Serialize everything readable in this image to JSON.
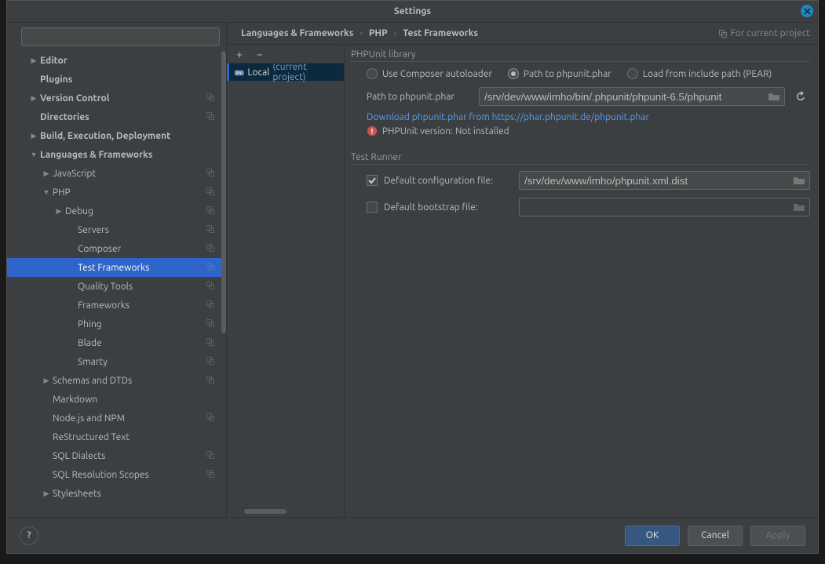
{
  "title": "Settings",
  "breadcrumb": [
    "Languages & Frameworks",
    "PHP",
    "Test Frameworks"
  ],
  "for_project_label": "For current project",
  "sidebar": {
    "search_placeholder": "",
    "items": [
      {
        "label": "Editor",
        "bold": true,
        "indent": 1,
        "chev": "right"
      },
      {
        "label": "Plugins",
        "bold": true,
        "indent": 1,
        "chev": ""
      },
      {
        "label": "Version Control",
        "bold": true,
        "indent": 1,
        "chev": "right",
        "copy": true
      },
      {
        "label": "Directories",
        "bold": true,
        "indent": 1,
        "chev": "",
        "copy": true
      },
      {
        "label": "Build, Execution, Deployment",
        "bold": true,
        "indent": 1,
        "chev": "right"
      },
      {
        "label": "Languages & Frameworks",
        "bold": true,
        "indent": 1,
        "chev": "down"
      },
      {
        "label": "JavaScript",
        "indent": 2,
        "chev": "right",
        "copy": true
      },
      {
        "label": "PHP",
        "indent": 2,
        "chev": "down",
        "copy": true
      },
      {
        "label": "Debug",
        "indent": 3,
        "chev": "right",
        "copy": true
      },
      {
        "label": "Servers",
        "indent": 4,
        "copy": true
      },
      {
        "label": "Composer",
        "indent": 4,
        "copy": true
      },
      {
        "label": "Test Frameworks",
        "indent": 4,
        "copy": true,
        "selected": true
      },
      {
        "label": "Quality Tools",
        "indent": 4,
        "copy": true
      },
      {
        "label": "Frameworks",
        "indent": 4,
        "copy": true
      },
      {
        "label": "Phing",
        "indent": 4,
        "copy": true
      },
      {
        "label": "Blade",
        "indent": 4,
        "copy": true
      },
      {
        "label": "Smarty",
        "indent": 4,
        "copy": true
      },
      {
        "label": "Schemas and DTDs",
        "indent": 2,
        "chev": "right",
        "copy": true
      },
      {
        "label": "Markdown",
        "indent": 2
      },
      {
        "label": "Node.js and NPM",
        "indent": 2,
        "copy": true
      },
      {
        "label": "ReStructured Text",
        "indent": 2
      },
      {
        "label": "SQL Dialects",
        "indent": 2,
        "copy": true
      },
      {
        "label": "SQL Resolution Scopes",
        "indent": 2,
        "copy": true
      },
      {
        "label": "Stylesheets",
        "indent": 2,
        "chev": "right"
      }
    ]
  },
  "mid": {
    "add": "+",
    "remove": "−",
    "item_name": "Local",
    "item_suffix": "(current project)"
  },
  "phpunit": {
    "section": "PHPUnit library",
    "radio_composer": "Use Composer autoloader",
    "radio_phar": "Path to phpunit.phar",
    "radio_pear": "Load from include path (PEAR)",
    "path_label": "Path to phpunit.phar",
    "path_value": "/srv/dev/www/imho/bin/.phpunit/phpunit-6.5/phpunit",
    "download_link": "Download phpunit.phar from https://phar.phpunit.de/phpunit.phar",
    "version_text": "PHPUnit version: Not installed"
  },
  "runner": {
    "section": "Test Runner",
    "default_config_label": "Default configuration file:",
    "default_config_value": "/srv/dev/www/imho/phpunit.xml.dist",
    "default_bootstrap_label": "Default bootstrap file:",
    "default_bootstrap_value": ""
  },
  "footer": {
    "ok": "OK",
    "cancel": "Cancel",
    "apply": "Apply"
  }
}
